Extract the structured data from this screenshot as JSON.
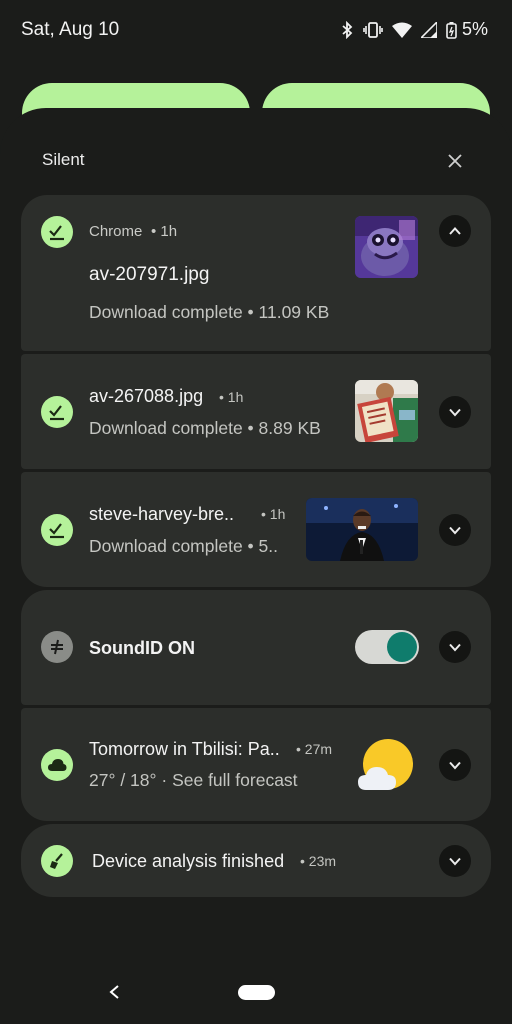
{
  "status_bar": {
    "date": "Sat, Aug 10",
    "battery": "5%",
    "icons": [
      "bluetooth-icon",
      "vibrate-icon",
      "wifi-icon",
      "signal-icon",
      "battery-icon"
    ]
  },
  "shade": {
    "section_title": "Silent",
    "dismiss_icon": "close-icon"
  },
  "notifications": [
    {
      "app": "Chrome",
      "meta_time": "• 1h",
      "title": "av-207971.jpg",
      "text": "Download complete • 11.09 KB",
      "icon": "download-done-icon",
      "expanded": true
    },
    {
      "title": "av-267088.jpg",
      "time": "• 1h",
      "text": "Download complete • 8.89 KB",
      "icon": "download-done-icon"
    },
    {
      "title": "steve-harvey-bre..",
      "time": "• 1h",
      "text": "Download complete • 5..",
      "icon": "download-done-icon"
    },
    {
      "title": "SoundID ON",
      "icon": "soundid-icon",
      "toggle_on": true
    },
    {
      "title": "Tomorrow in Tbilisi: Pa..",
      "time": "• 27m",
      "text": "27° / 18° · See full forecast",
      "icon": "cloud-icon",
      "weather_icon": "partly-sunny-icon"
    },
    {
      "title": "Device analysis finished",
      "time": "• 23m",
      "icon": "broom-icon"
    }
  ],
  "colors": {
    "accent_green": "#b5f29a",
    "card": "#2c2e2b",
    "background": "#1b1c1a",
    "toggle_knob": "#0f7c6c"
  }
}
